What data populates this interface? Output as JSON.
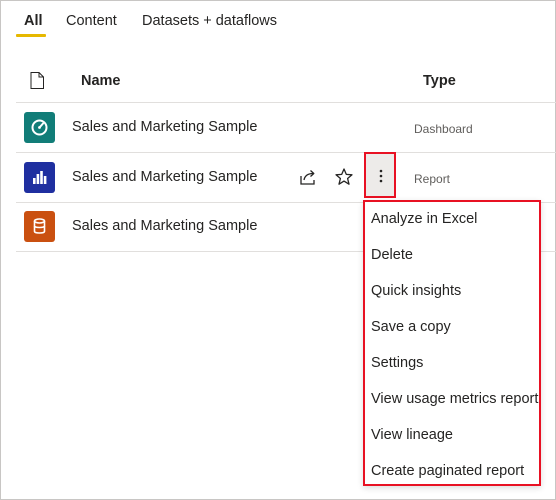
{
  "tabs": [
    {
      "label": "All"
    },
    {
      "label": "Content"
    },
    {
      "label": "Datasets + dataflows"
    }
  ],
  "table": {
    "headers": {
      "name": "Name",
      "type": "Type"
    },
    "rows": [
      {
        "name": "Sales and Marketing Sample",
        "type": "Dashboard",
        "icon": "gauge-icon",
        "icon_color": "#117d78"
      },
      {
        "name": "Sales and Marketing Sample",
        "type": "Report",
        "icon": "bar-chart-icon",
        "icon_color": "#1f2fa0"
      },
      {
        "name": "Sales and Marketing Sample",
        "type": "",
        "icon": "database-icon",
        "icon_color": "#ca5010"
      }
    ]
  },
  "context_menu": {
    "items": [
      {
        "label": "Analyze in Excel"
      },
      {
        "label": "Delete"
      },
      {
        "label": "Quick insights"
      },
      {
        "label": "Save a copy"
      },
      {
        "label": "Settings"
      },
      {
        "label": "View usage metrics report"
      },
      {
        "label": "View lineage"
      },
      {
        "label": "Create paginated report"
      }
    ]
  },
  "colors": {
    "highlight_border": "#e81123",
    "tab_underline": "#e6b800",
    "divider": "#e1dfdd"
  }
}
